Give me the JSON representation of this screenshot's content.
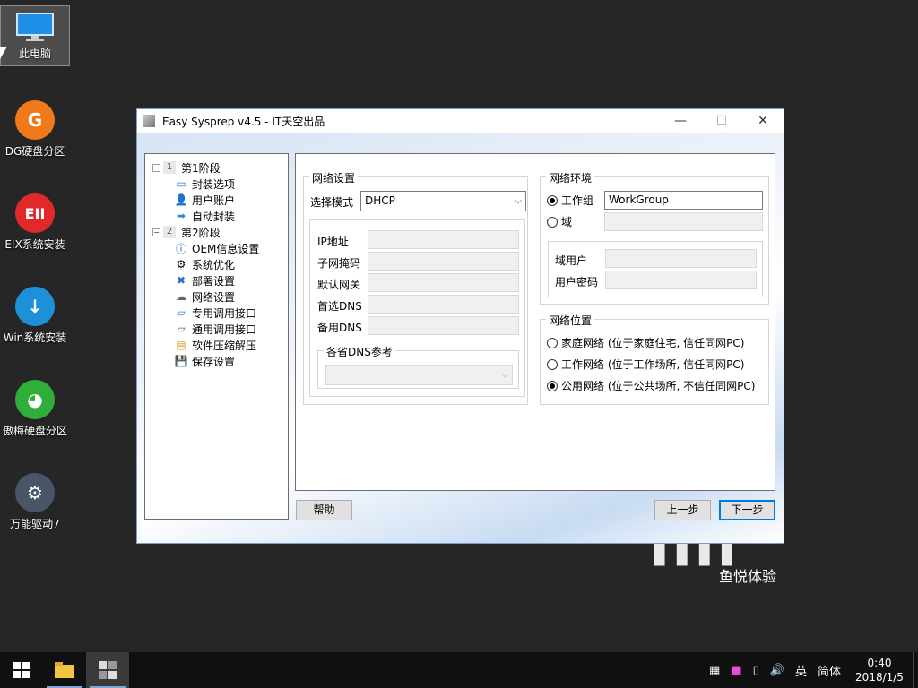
{
  "desktop": {
    "icons": [
      {
        "label": "此电脑"
      },
      {
        "label": "DG硬盘分区"
      },
      {
        "label": "EIX系统安装"
      },
      {
        "label": "Win系统安装"
      },
      {
        "label": "傲梅硬盘分区"
      },
      {
        "label": "万能驱动7"
      }
    ],
    "brand_small": "鱼悦体验"
  },
  "window": {
    "title": "Easy Sysprep v4.5 - IT天空出品",
    "tree": {
      "stage1": {
        "num": "1",
        "label": "第1阶段",
        "items": [
          "封装选项",
          "用户账户",
          "自动封装"
        ]
      },
      "stage2": {
        "num": "2",
        "label": "第2阶段",
        "items": [
          "OEM信息设置",
          "系统优化",
          "部署设置",
          "网络设置",
          "专用调用接口",
          "通用调用接口",
          "软件压缩解压",
          "保存设置"
        ]
      }
    },
    "network_settings": {
      "title": "网络设置",
      "mode_label": "选择模式",
      "mode_value": "DHCP",
      "ip_label": "IP地址",
      "mask_label": "子网掩码",
      "gateway_label": "默认网关",
      "dns1_label": "首选DNS",
      "dns2_label": "备用DNS",
      "dns_ref_title": "各省DNS参考"
    },
    "network_env": {
      "title": "网络环境",
      "workgroup_label": "工作组",
      "workgroup_value": "WorkGroup",
      "domain_label": "域",
      "domain_user_label": "域用户",
      "domain_pass_label": "用户密码"
    },
    "network_location": {
      "title": "网络位置",
      "options": [
        {
          "label": "家庭网络 (位于家庭住宅, 信任同网PC)",
          "checked": false
        },
        {
          "label": "工作网络 (位于工作场所, 信任同网PC)",
          "checked": false
        },
        {
          "label": "公用网络 (位于公共场所, 不信任同网PC)",
          "checked": true
        }
      ]
    },
    "buttons": {
      "help": "帮助",
      "prev": "上一步",
      "next": "下一步"
    }
  },
  "taskbar": {
    "ime_lang": "英",
    "ime_mode": "简体",
    "time": "0:40",
    "date": "2018/1/5"
  }
}
